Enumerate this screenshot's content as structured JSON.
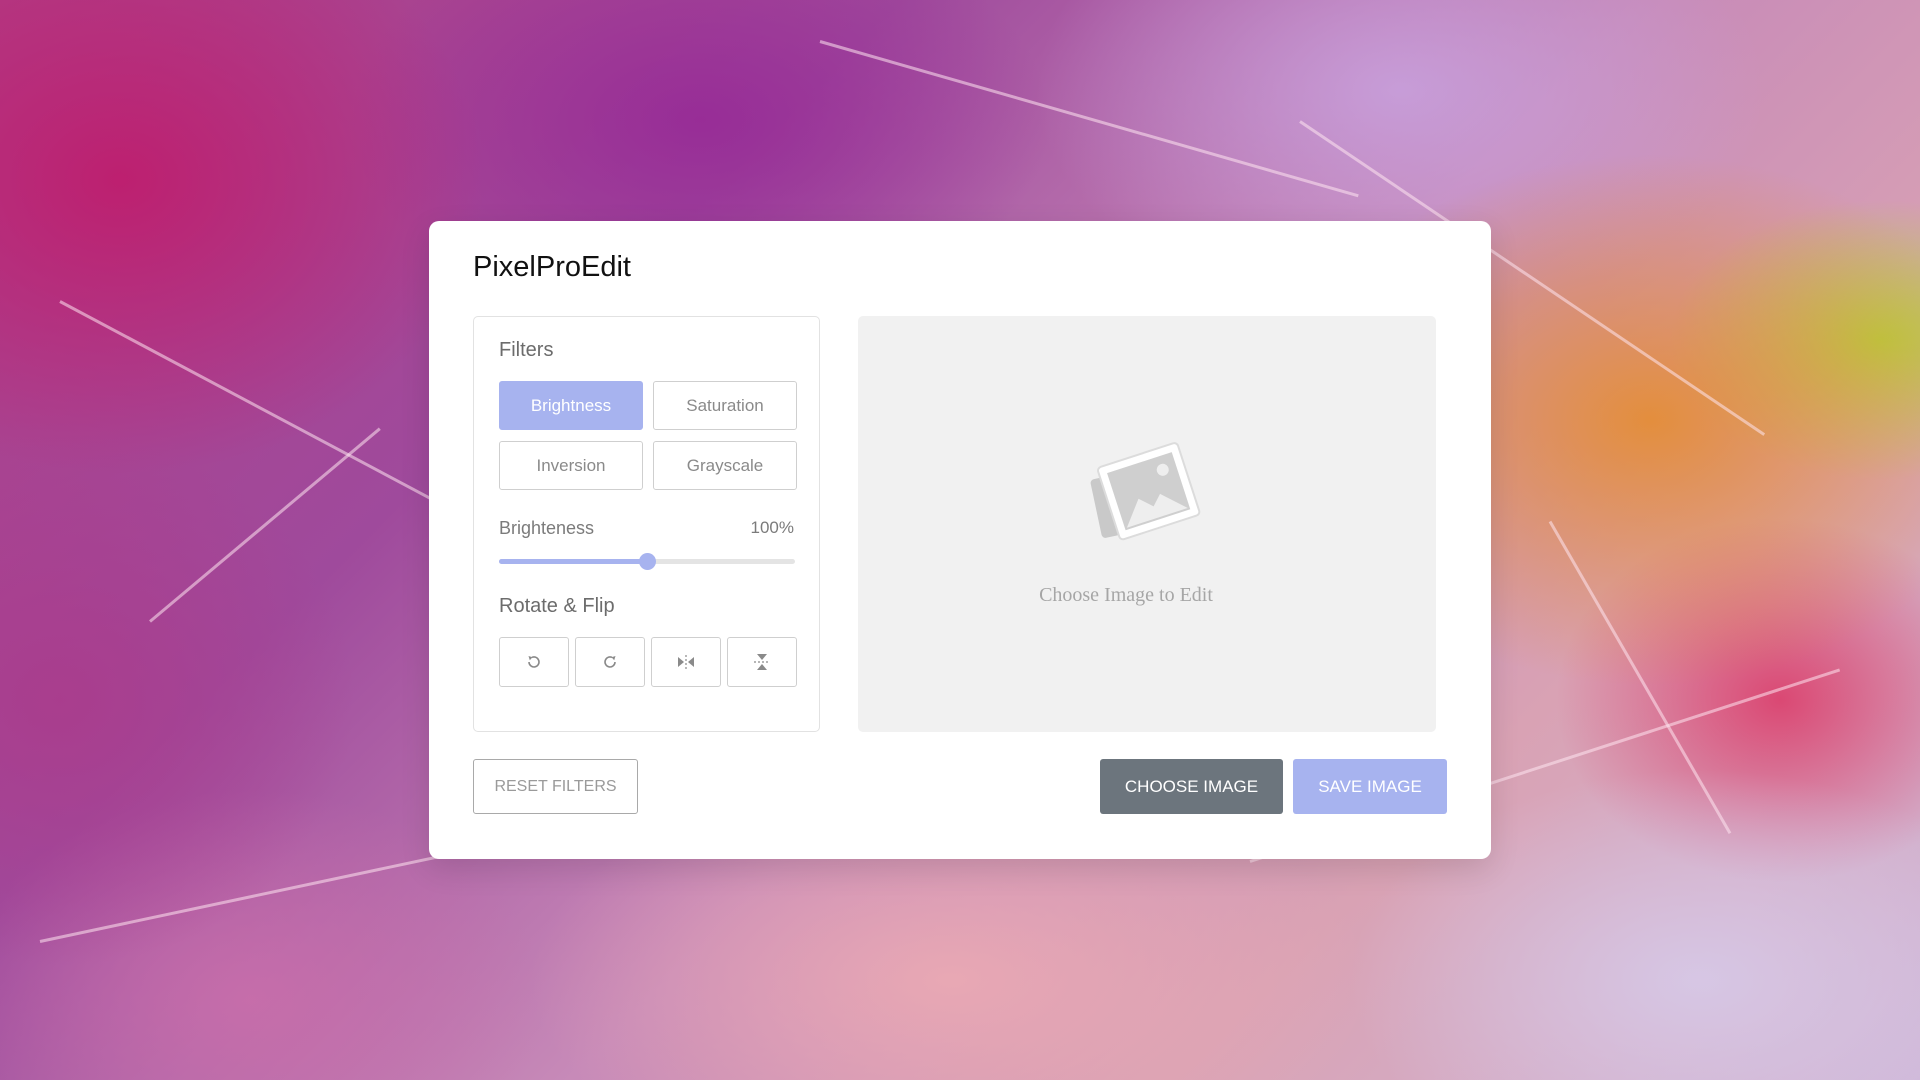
{
  "app": {
    "title": "PixelProEdit"
  },
  "filters": {
    "section_label": "Filters",
    "options": [
      {
        "label": "Brightness",
        "active": true
      },
      {
        "label": "Saturation",
        "active": false
      },
      {
        "label": "Inversion",
        "active": false
      },
      {
        "label": "Grayscale",
        "active": false
      }
    ],
    "slider": {
      "label": "Brighteness",
      "value_text": "100%",
      "level_fraction": 0.5
    }
  },
  "rotate_flip": {
    "section_label": "Rotate & Flip",
    "buttons": [
      {
        "icon": "rotate-left-icon"
      },
      {
        "icon": "rotate-right-icon"
      },
      {
        "icon": "flip-horizontal-icon"
      },
      {
        "icon": "flip-vertical-icon"
      }
    ]
  },
  "preview": {
    "placeholder_text": "Choose Image to Edit",
    "icon": "image-placeholder-icon"
  },
  "actions": {
    "reset_label": "RESET FILTERS",
    "choose_label": "CHOOSE IMAGE",
    "save_label": "SAVE IMAGE"
  },
  "colors": {
    "accent": "#a7b3ef",
    "choose_button": "#6c757d",
    "preview_background": "#f1f1f1"
  }
}
